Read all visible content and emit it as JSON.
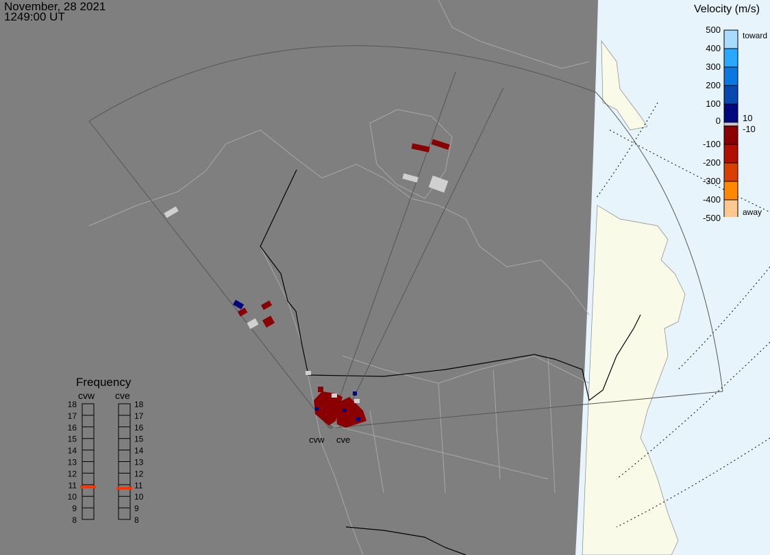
{
  "header": {
    "date": "November, 28 2021",
    "time": "1249:00 UT"
  },
  "velocity_scale": {
    "title": "Velocity (m/s)",
    "ticks": [
      "500",
      "400",
      "300",
      "200",
      "100",
      "0",
      "-100",
      "-200",
      "-300",
      "-400",
      "-500"
    ],
    "toward_label": "toward",
    "away_label": "away",
    "ground_scatter_upper": "10",
    "ground_scatter_lower": "-10",
    "colors": [
      "#a8dcff",
      "#28a8ff",
      "#0a78e0",
      "#0848b0",
      "#00087e",
      "#c8c8c8",
      "#8a0000",
      "#b01000",
      "#d84000",
      "#ff8800",
      "#ffc890"
    ]
  },
  "frequency_panel": {
    "title": "Frequency",
    "radars": [
      {
        "name": "cvw",
        "frequency_mhz": 10.8
      },
      {
        "name": "cve",
        "frequency_mhz": 10.7
      }
    ],
    "ticks": [
      "18",
      "17",
      "16",
      "15",
      "14",
      "13",
      "12",
      "11",
      "10",
      "9",
      "8"
    ],
    "range": [
      8,
      18
    ],
    "marker_color": "#ff3300"
  },
  "map": {
    "site_labels": [
      "cvw",
      "cve"
    ],
    "night_color": "#7f7f7f",
    "day_ocean_color": "#e8f4fc",
    "day_land_color": "#fafae8"
  }
}
